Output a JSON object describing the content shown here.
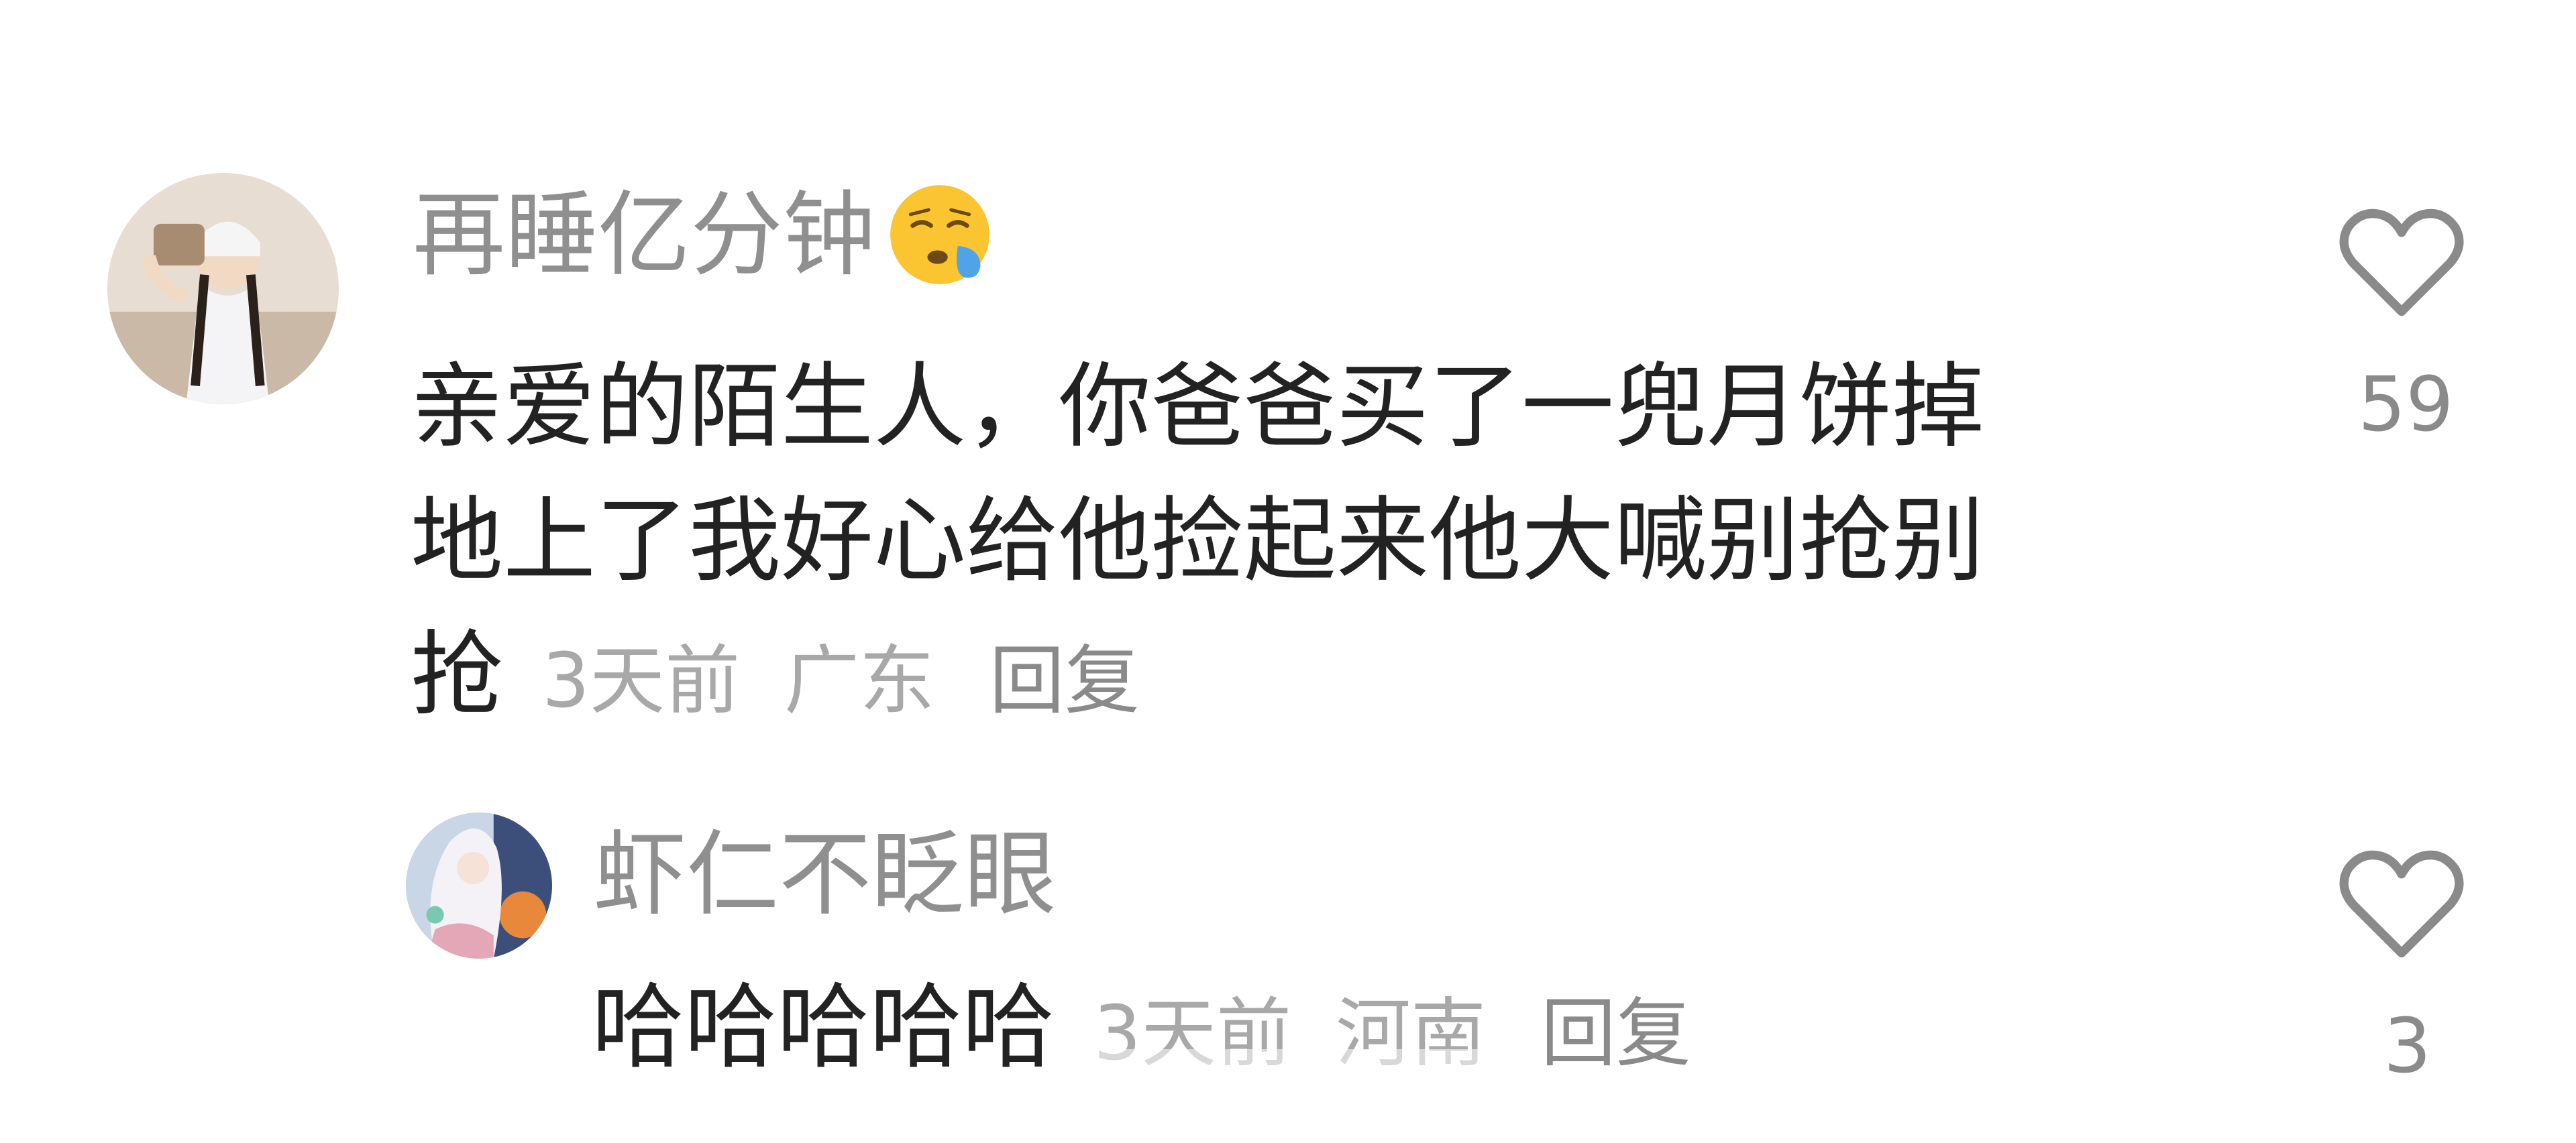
{
  "comments": [
    {
      "username": "再睡亿分钟",
      "username_emoji": "sleeping-face-emoji",
      "text_lines": [
        "亲爱的陌生人，你爸爸买了一兜月饼掉",
        "地上了我好心给他捡起来他大喊别抢别",
        "抢"
      ],
      "time": "3天前",
      "location": "广东",
      "reply_label": "回复",
      "likes": "59"
    },
    {
      "username": "虾仁不眨眼",
      "text": "哈哈哈哈哈",
      "time": "3天前",
      "location": "河南",
      "reply_label": "回复",
      "likes": "3"
    }
  ],
  "colors": {
    "text": "#222222",
    "username": "#8f8f8f",
    "meta": "#a8a8a8",
    "icon": "#8a8a8a"
  }
}
